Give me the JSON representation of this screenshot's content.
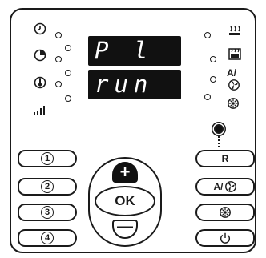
{
  "display": {
    "line1": "P l",
    "line2": "run"
  },
  "left_indicators": [
    {
      "icon": "clock-icon"
    },
    {
      "icon": "timer-quarter-icon"
    },
    {
      "icon": "thermometer-icon"
    },
    {
      "icon": "signal-bars-icon"
    }
  ],
  "right_indicators": [
    {
      "icon": "heat-waves-icon"
    },
    {
      "icon": "heat-grid-icon"
    },
    {
      "icon": "auto-fan-icon",
      "label": "A/"
    },
    {
      "icon": "fan-speed-icon"
    }
  ],
  "left_buttons": [
    {
      "label": "1"
    },
    {
      "label": "2"
    },
    {
      "label": "3"
    },
    {
      "label": "4"
    }
  ],
  "right_buttons": {
    "reset_label": "R",
    "auto_fan_label": "A/",
    "fan_icon": "fan-icon",
    "power_icon": "power-icon"
  },
  "nav": {
    "plus": "+",
    "ok": "OK",
    "minus": "—"
  },
  "colors": {
    "display_bg": "#111111",
    "display_text": "#ffffff",
    "line": "#1a1a1a"
  }
}
